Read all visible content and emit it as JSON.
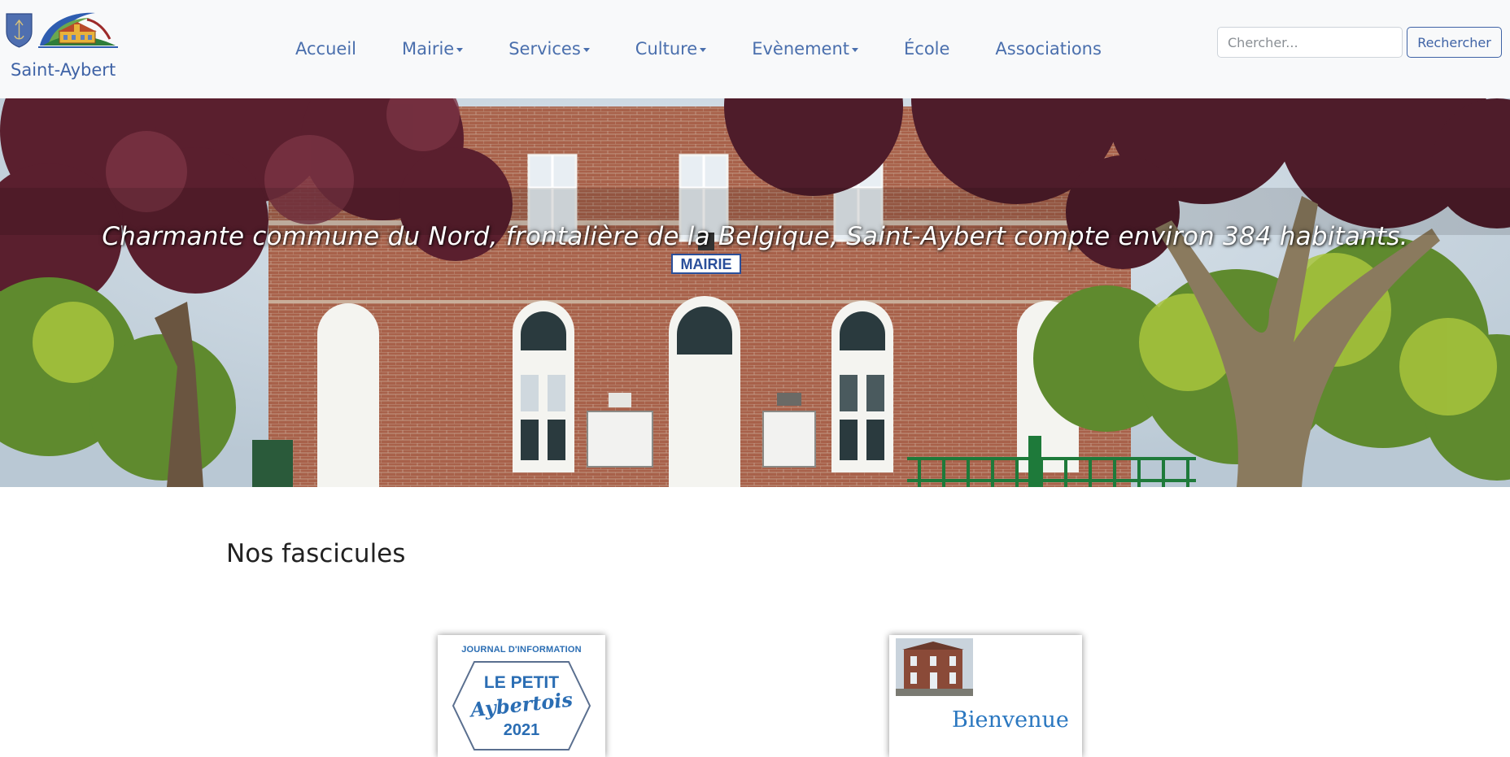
{
  "site": {
    "name": "Saint-Aybert"
  },
  "nav": {
    "items": [
      {
        "label": "Accueil",
        "dropdown": false
      },
      {
        "label": "Mairie",
        "dropdown": true
      },
      {
        "label": "Services",
        "dropdown": true
      },
      {
        "label": "Culture",
        "dropdown": true
      },
      {
        "label": "Evènement",
        "dropdown": true
      },
      {
        "label": "École",
        "dropdown": false
      },
      {
        "label": "Associations",
        "dropdown": false
      }
    ]
  },
  "search": {
    "placeholder": "Chercher...",
    "button_label": "Rechercher"
  },
  "hero": {
    "tagline": "Charmante commune du Nord, frontalière de la Belgique, Saint-Aybert compte environ 384 habitants.",
    "sign": "MAIRIE"
  },
  "main": {
    "section_title": "Nos fascicules",
    "cards": [
      {
        "kicker": "JOURNAL D'INFORMATION",
        "line1": "LE PETIT",
        "line2": "Aybertois",
        "line3": "2021"
      },
      {
        "title": "Bienvenue"
      }
    ]
  },
  "colors": {
    "brand_blue": "#3f63a6",
    "navbar_bg": "#f8f9fa",
    "accent_blue": "#2a6db3"
  }
}
